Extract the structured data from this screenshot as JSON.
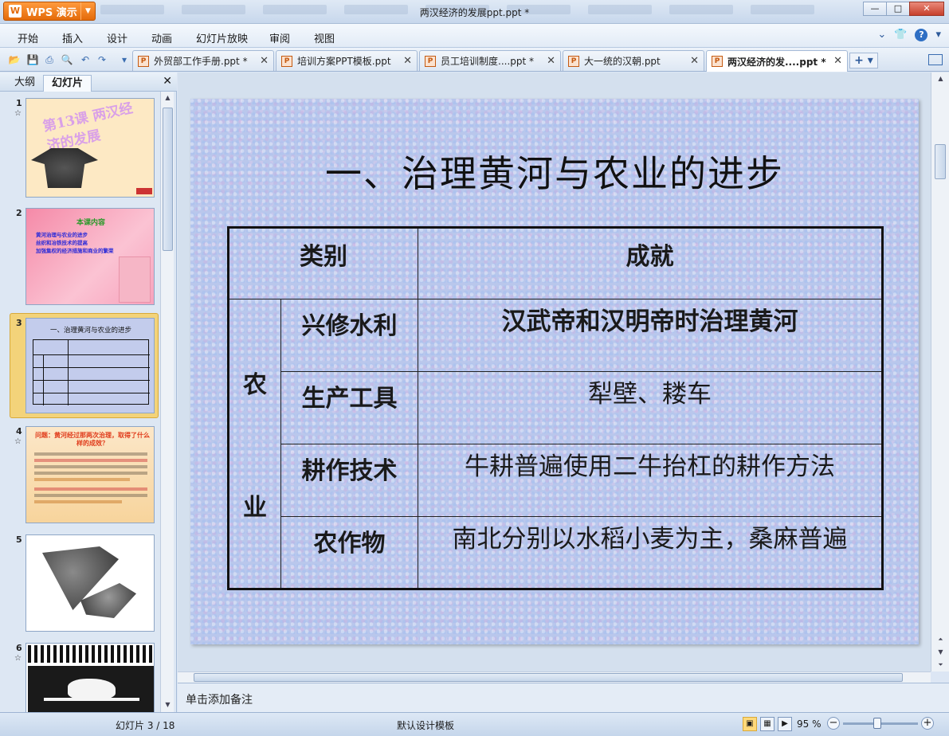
{
  "window": {
    "app_button": "WPS 演示",
    "title": "两汉经济的发展ppt.ppt *"
  },
  "menu": [
    "开始",
    "插入",
    "设计",
    "动画",
    "幻灯片放映",
    "审阅",
    "视图"
  ],
  "doc_tabs": [
    {
      "label": "外贸部工作手册.ppt *"
    },
    {
      "label": "培训方案PPT模板.ppt"
    },
    {
      "label": "员工培训制度....ppt *"
    },
    {
      "label": "大一统的汉朝.ppt"
    },
    {
      "label": "两汉经济的发....ppt *"
    }
  ],
  "left_panel": {
    "tab_outline": "大纲",
    "tab_slides": "幻灯片",
    "thumbs": [
      {
        "num": "1",
        "title": "第13课 两汉经济的发展"
      },
      {
        "num": "2",
        "title": "本课内容",
        "lines": [
          "黄河治理与农业的进步",
          "丝织和冶铁技术的提高",
          "加强集权的经济措施和商业的繁荣"
        ]
      },
      {
        "num": "3",
        "title": "一、治理黄河与农业的进步"
      },
      {
        "num": "4",
        "title": "问题：黄河经过那两次治理，取得了什么样的成效？"
      },
      {
        "num": "5"
      },
      {
        "num": "6"
      }
    ]
  },
  "slide": {
    "title": "一、治理黄河与农业的进步",
    "table": {
      "header_category": "类别",
      "header_achievement": "成就",
      "category_char1": "农",
      "category_char2": "业",
      "rows": [
        {
          "item": "兴修水利",
          "value": "汉武帝和汉明帝时治理黄河"
        },
        {
          "item": "生产工具",
          "value": "犁壁、耧车"
        },
        {
          "item": "耕作技术",
          "value": "牛耕普遍使用二牛抬杠的耕作方法"
        },
        {
          "item": "农作物",
          "value": "南北分别以水稻小麦为主，桑麻普遍"
        }
      ]
    }
  },
  "notes_placeholder": "单击添加备注",
  "status": {
    "slide_info": "幻灯片 3 / 18",
    "template": "默认设计模板",
    "zoom": "95 %"
  }
}
